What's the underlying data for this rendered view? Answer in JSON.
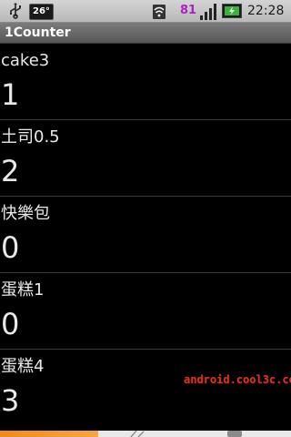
{
  "status_bar": {
    "battery_badge": "26°",
    "signal_number": "81",
    "time": "22:28",
    "icons": [
      "usb-icon",
      "wifi-icon",
      "signal-icon",
      "charging-icon"
    ],
    "signal_number_color": "#b020c0"
  },
  "app": {
    "title": "1Counter"
  },
  "counters": [
    {
      "name": "cake3",
      "count": "1"
    },
    {
      "name": "土司0.5",
      "count": "2"
    },
    {
      "name": "快樂包",
      "count": "0"
    },
    {
      "name": "蛋糕1",
      "count": "0"
    },
    {
      "name": "蛋糕4",
      "count": "3"
    }
  ],
  "watermark": "android.cool3c.com",
  "colors": {
    "background": "#000000",
    "accent_orange": "#f08a1c",
    "watermark": "#d43a1a"
  }
}
